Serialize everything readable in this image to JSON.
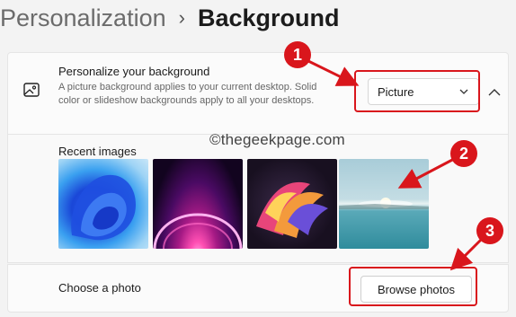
{
  "breadcrumb": {
    "parent": "Personalization",
    "separator": "›",
    "current": "Background"
  },
  "background_setting": {
    "title": "Personalize your background",
    "description": "A picture background applies to your current desktop. Solid color or slideshow backgrounds apply to all your desktops.",
    "dropdown_value": "Picture"
  },
  "recent": {
    "label": "Recent images",
    "watermark": "©thegeekpage.com",
    "images": [
      "blue-bloom",
      "purple-glow",
      "abstract-ribbons",
      "lake-sunrise"
    ]
  },
  "choose": {
    "label": "Choose a photo",
    "button": "Browse photos"
  },
  "annotations": {
    "step1": "1",
    "step2": "2",
    "step3": "3",
    "color": "#d9161c"
  }
}
